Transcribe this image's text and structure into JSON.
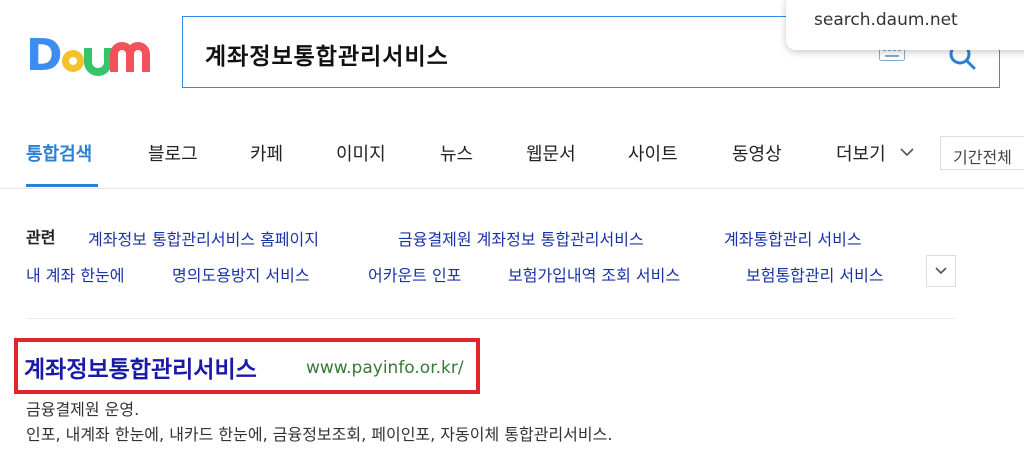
{
  "header": {
    "logo_text": "Daum",
    "search_query": "계좌정보통합관리서비스",
    "url_popup": "search.daum.net"
  },
  "tabs": {
    "items": [
      "통합검색",
      "블로그",
      "카페",
      "이미지",
      "뉴스",
      "웹문서",
      "사이트",
      "동영상",
      "더보기"
    ],
    "active": "통합검색",
    "period": "기간전체"
  },
  "related": {
    "label": "관련",
    "links": [
      "계좌정보 통합관리서비스 홈페이지",
      "금융결제원 계좌정보 통합관리서비스",
      "계좌통합관리 서비스",
      "내 계좌 한눈에",
      "명의도용방지 서비스",
      "어카운트 인포",
      "보험가입내역 조회 서비스",
      "보험통합관리 서비스"
    ]
  },
  "result": {
    "title": "계좌정보통합관리서비스",
    "url": "www.payinfo.or.kr/",
    "desc_line1": "금융결제원 운영.",
    "desc_line2": "인포, 내계좌 한눈에, 내카드 한눈에, 금융정보조회, 페이인포, 자동이체 통합관리서비스."
  },
  "colors": {
    "accent": "#2d7fd6",
    "link": "#1a33a8",
    "highlight": "#e0262d",
    "url_green": "#377a37"
  }
}
